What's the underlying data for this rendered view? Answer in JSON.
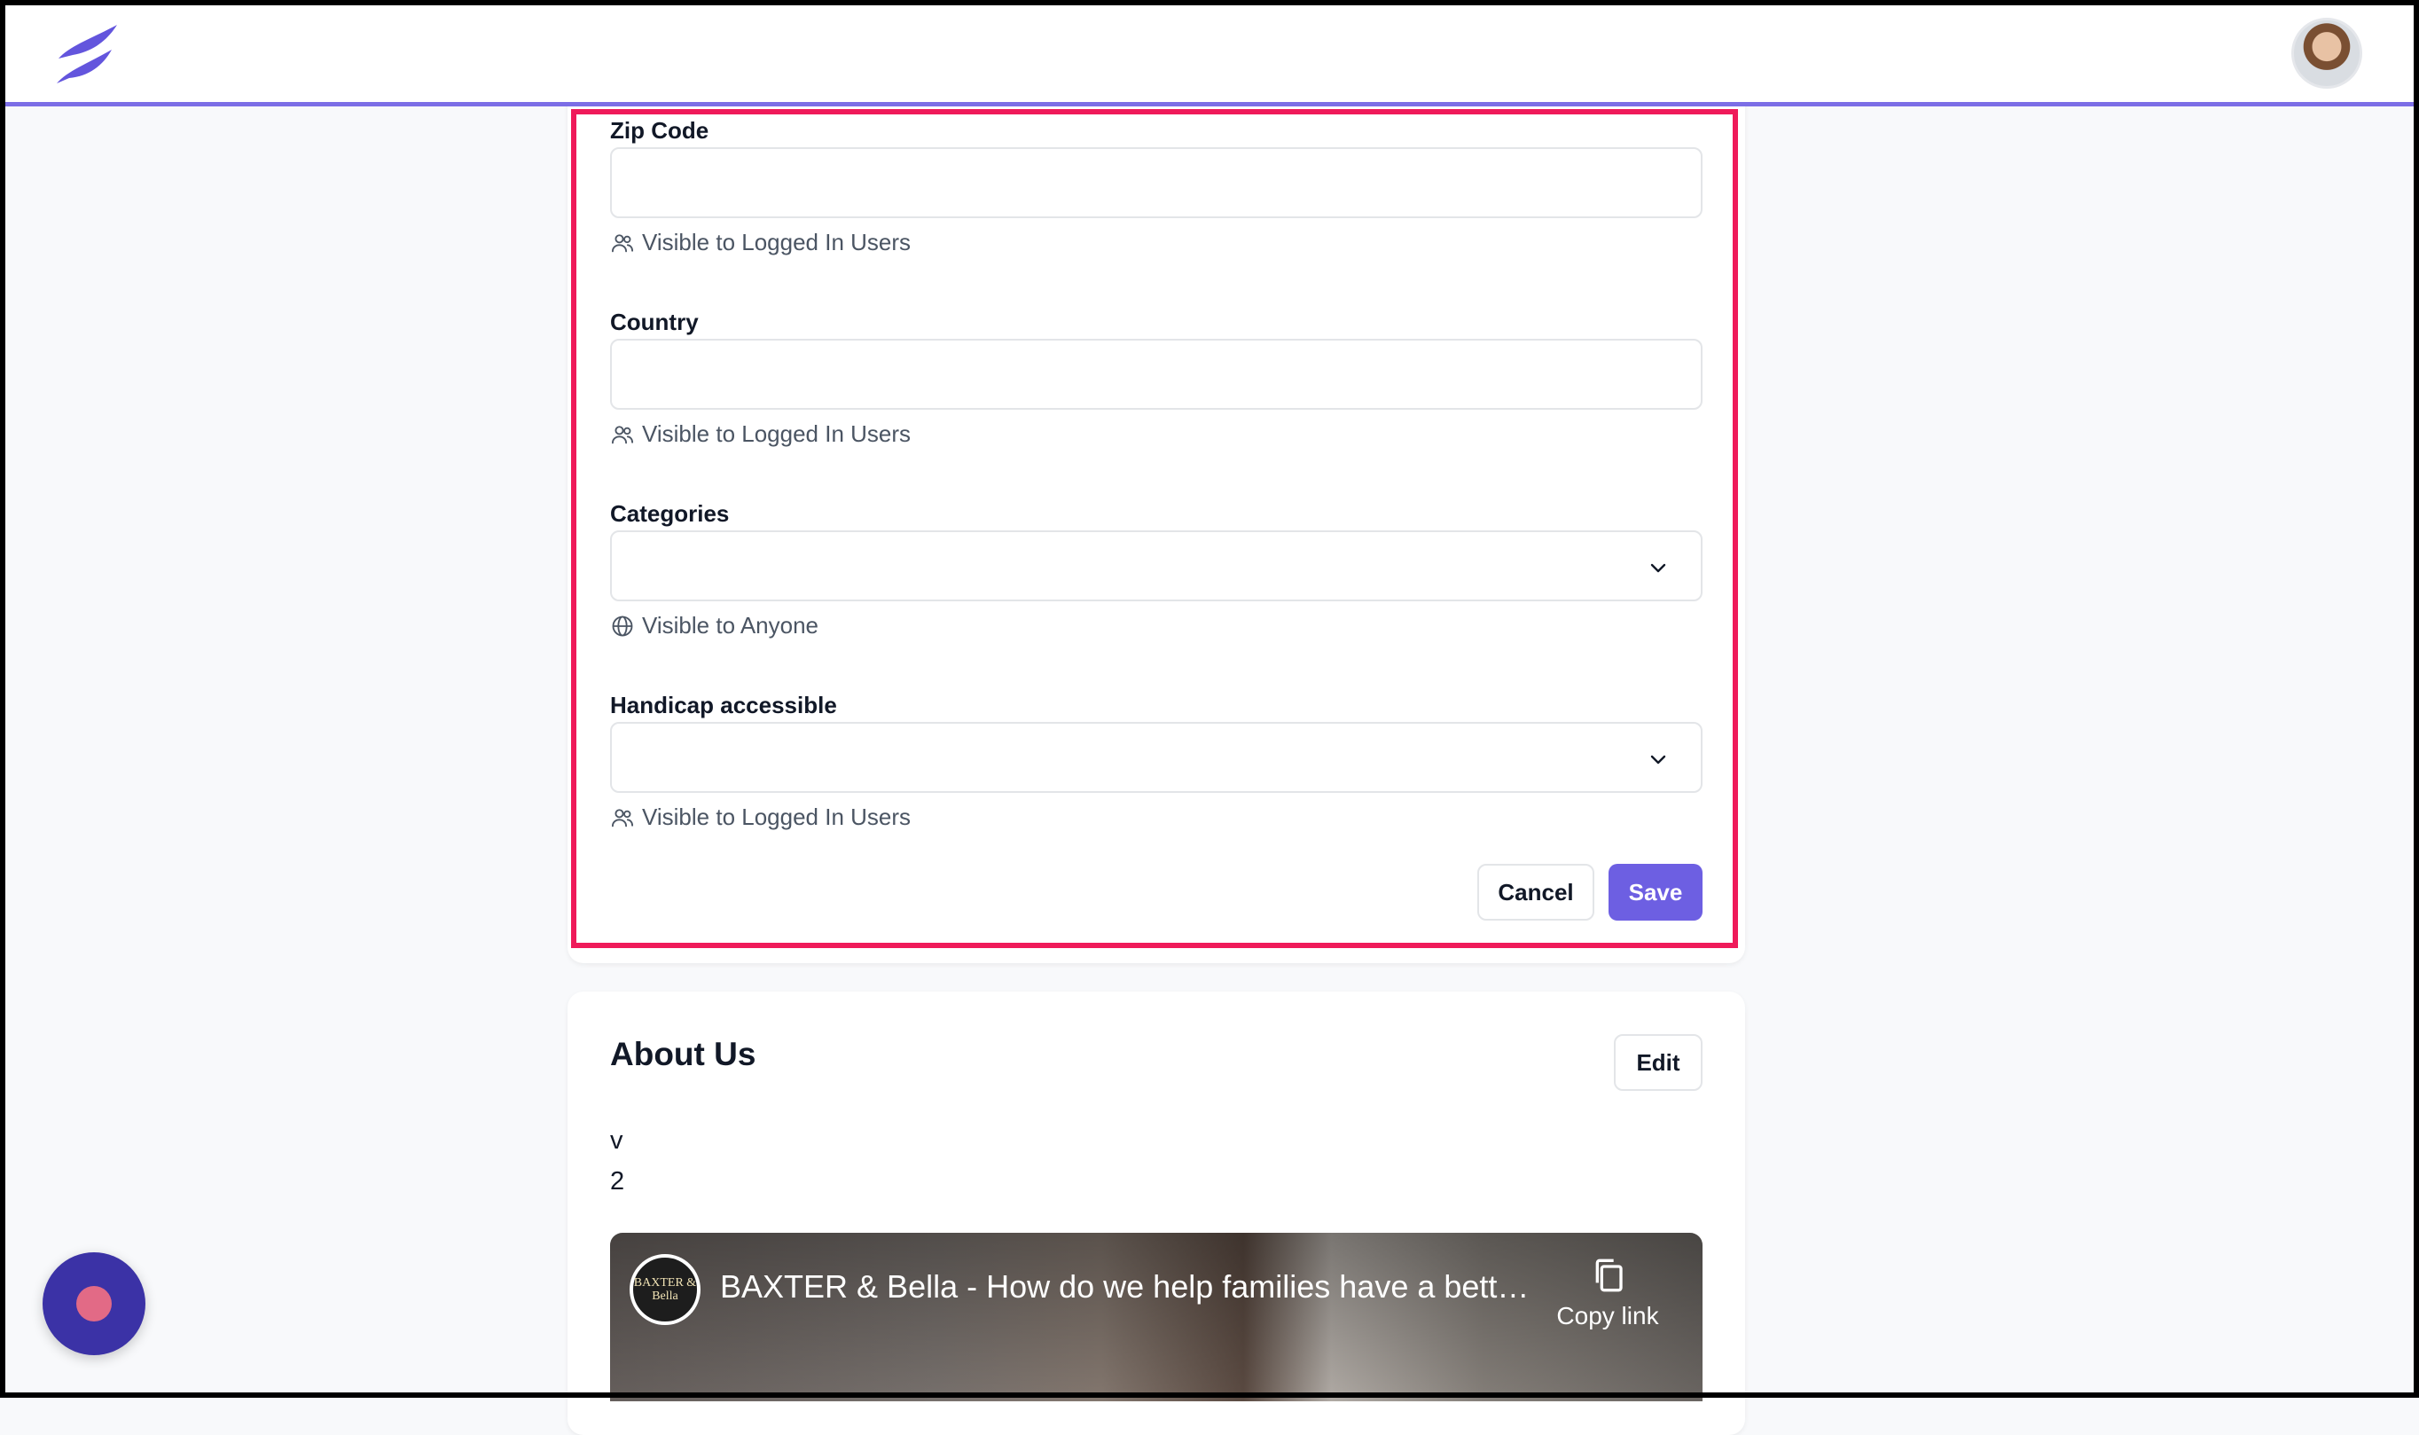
{
  "header": {
    "logo_icon": "leaf-logo-icon",
    "avatar": "user-avatar"
  },
  "form": {
    "fields": [
      {
        "label": "Zip Code",
        "type": "text",
        "value": "",
        "visibility": "Visible to Logged In Users",
        "visibility_icon": "users-icon"
      },
      {
        "label": "Country",
        "type": "text",
        "value": "",
        "visibility": "Visible to Logged In Users",
        "visibility_icon": "users-icon"
      },
      {
        "label": "Categories",
        "type": "select",
        "value": "",
        "visibility": "Visible to Anyone",
        "visibility_icon": "globe-icon"
      },
      {
        "label": "Handicap accessible",
        "type": "select",
        "value": "",
        "visibility": "Visible to Logged In Users",
        "visibility_icon": "users-icon"
      }
    ],
    "cancel_label": "Cancel",
    "save_label": "Save"
  },
  "about": {
    "title": "About Us",
    "edit_label": "Edit",
    "lines": [
      "v",
      "2"
    ],
    "video": {
      "channel_badge": "BAXTER & Bella",
      "title": "BAXTER & Bella - How do we help families have a better ...",
      "copy_link_label": "Copy link"
    }
  },
  "colors": {
    "accent": "#6d5fe2",
    "highlight": "#ef1a5a",
    "fab": "#3b32a6"
  }
}
